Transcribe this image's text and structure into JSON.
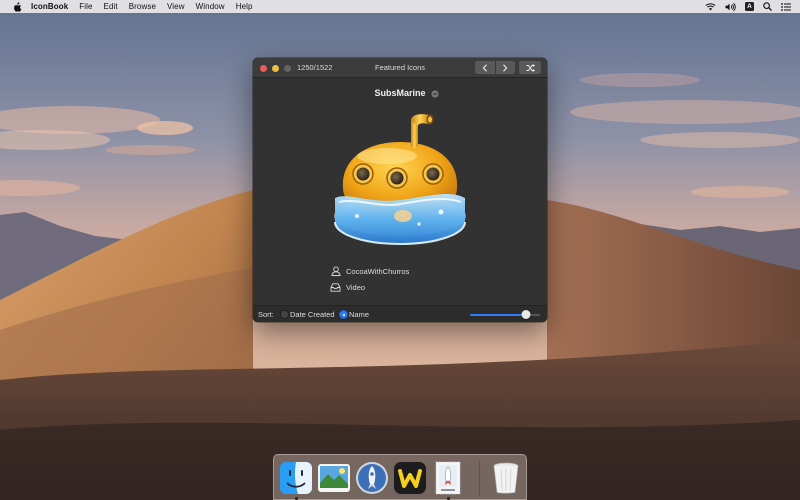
{
  "menubar": {
    "apple_icon": "apple-logo-icon",
    "app_name": "IconBook",
    "menus": [
      "File",
      "Edit",
      "Browse",
      "View",
      "Window",
      "Help"
    ],
    "status": {
      "wifi_icon": "wifi-icon",
      "volume_icon": "volume-icon",
      "input_source": "A",
      "search_icon": "spotlight-search-icon",
      "notifications_icon": "notification-center-icon"
    }
  },
  "window": {
    "counter": "1250/1522",
    "title": "Featured Icons",
    "nav": {
      "prev_icon": "chevron-left-icon",
      "next_icon": "chevron-right-icon",
      "shuffle_icon": "shuffle-icon"
    },
    "icon_name": "SubsMarine",
    "author": "CocoaWithChurros",
    "category": "Video",
    "sort": {
      "label": "Sort:",
      "options": [
        {
          "label": "Date Created",
          "selected": false
        },
        {
          "label": "Name",
          "selected": true
        }
      ]
    },
    "zoom_level": 0.8
  },
  "dock": {
    "items": [
      {
        "name": "finder-icon",
        "running": true
      },
      {
        "name": "photos-app-icon",
        "running": false
      },
      {
        "name": "launchpad-rocket-icon",
        "running": false
      },
      {
        "name": "w-app-icon",
        "running": false
      },
      {
        "name": "iconbook-app-icon",
        "running": true
      }
    ],
    "trash": "trash-icon"
  },
  "colors": {
    "accent": "#2f7cf6",
    "window_bg": "#333232",
    "close": "#ee5c55",
    "minimize": "#f2be3e",
    "zoom": "#646464",
    "submarine": "#f0a316"
  }
}
